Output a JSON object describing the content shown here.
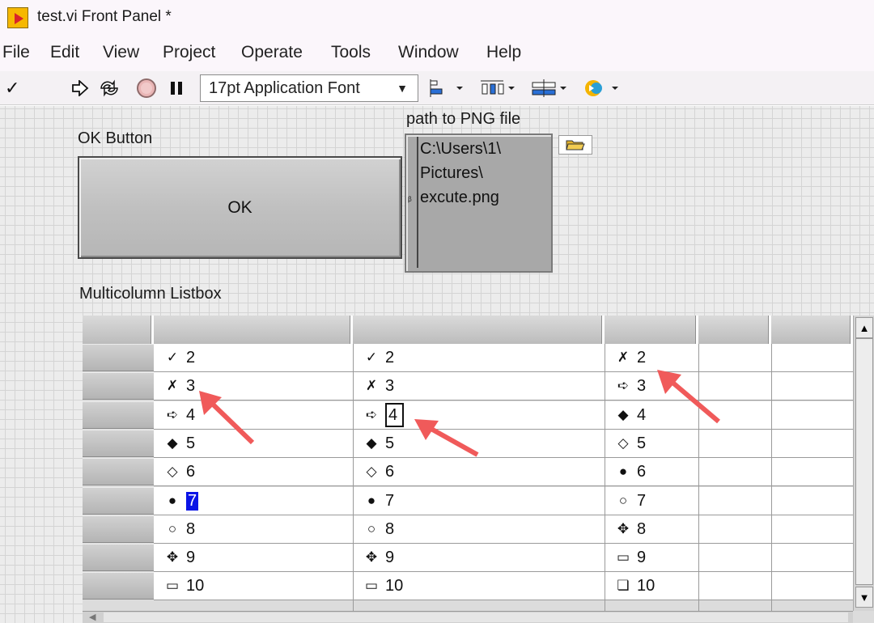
{
  "window": {
    "title": "test.vi Front Panel *"
  },
  "menu": [
    "File",
    "Edit",
    "View",
    "Project",
    "Operate",
    "Tools",
    "Window",
    "Help"
  ],
  "toolbar": {
    "run_check": "✓",
    "font": "17pt Application Font"
  },
  "panel": {
    "ok_label": "OK Button",
    "ok_text": "OK",
    "path_label": "path to PNG file",
    "path_lines": [
      "C:\\Users\\1\\",
      "Pictures\\",
      "excute.png"
    ],
    "listbox_label": "Multicolumn Listbox"
  },
  "listbox": {
    "rows": [
      [
        {
          "sym": "✓",
          "val": "2"
        },
        {
          "sym": "✓",
          "val": "2"
        },
        {
          "sym": "✗",
          "val": "2"
        }
      ],
      [
        {
          "sym": "✗",
          "val": "3"
        },
        {
          "sym": "✗",
          "val": "3"
        },
        {
          "sym": "➪",
          "val": "3"
        }
      ],
      [
        {
          "sym": "➪",
          "val": "4"
        },
        {
          "sym": "➪",
          "val": "4"
        },
        {
          "sym": "◆",
          "val": "4"
        }
      ],
      [
        {
          "sym": "◆",
          "val": "5"
        },
        {
          "sym": "◆",
          "val": "5"
        },
        {
          "sym": "◇",
          "val": "5"
        }
      ],
      [
        {
          "sym": "◇",
          "val": "6"
        },
        {
          "sym": "◇",
          "val": "6"
        },
        {
          "sym": "●",
          "val": "6"
        }
      ],
      [
        {
          "sym": "●",
          "val": "7"
        },
        {
          "sym": "●",
          "val": "7"
        },
        {
          "sym": "○",
          "val": "7"
        }
      ],
      [
        {
          "sym": "○",
          "val": "8"
        },
        {
          "sym": "○",
          "val": "8"
        },
        {
          "sym": "✥",
          "val": "8"
        }
      ],
      [
        {
          "sym": "✥",
          "val": "9"
        },
        {
          "sym": "✥",
          "val": "9"
        },
        {
          "sym": "▭",
          "val": "9"
        }
      ],
      [
        {
          "sym": "▭",
          "val": "10"
        },
        {
          "sym": "▭",
          "val": "10"
        },
        {
          "sym": "❏",
          "val": "10"
        }
      ]
    ],
    "selected_cell": {
      "row": 5,
      "col": 0
    },
    "editing_cell": {
      "row": 2,
      "col": 1
    }
  },
  "colors": {
    "annotation_arrow": "#f05a5a",
    "selection": "#0a14e6"
  }
}
